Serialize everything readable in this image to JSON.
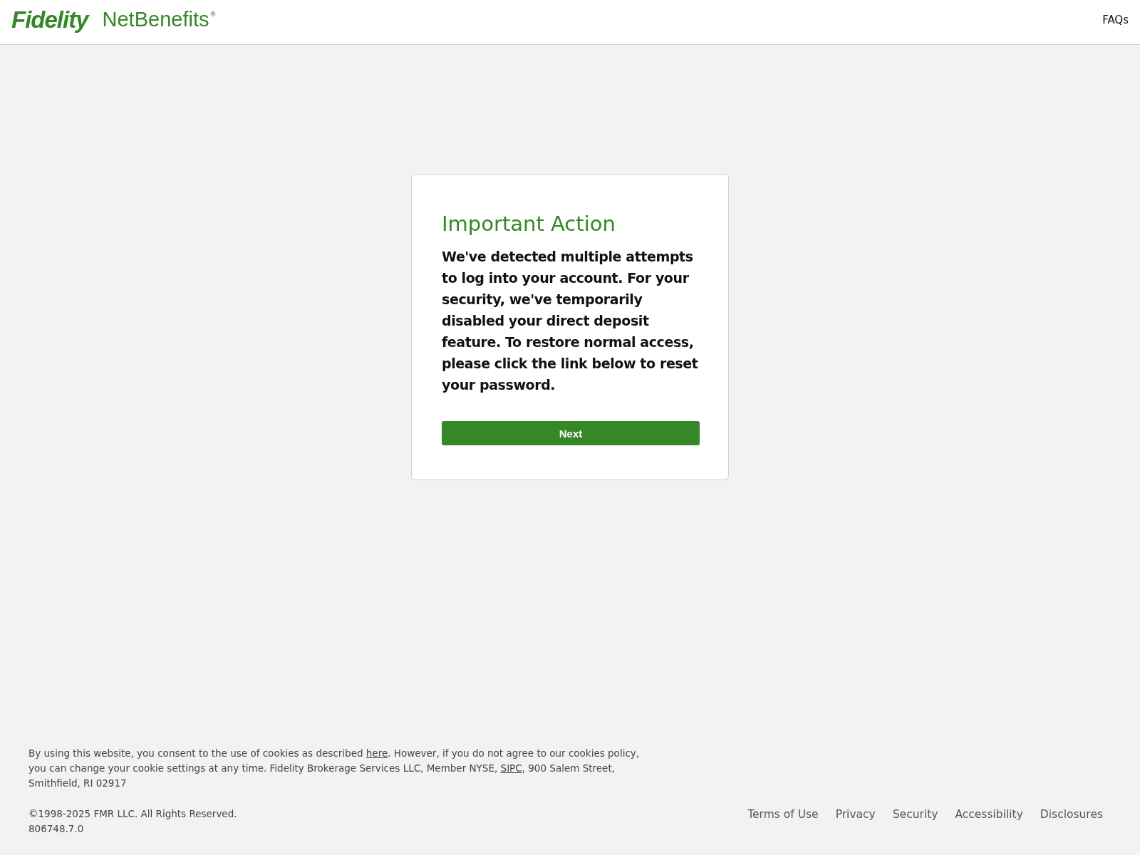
{
  "header": {
    "logo_brand": "Fidelity",
    "logo_product": "NetBenefits",
    "logo_mark": "®",
    "faqs_link": "FAQs"
  },
  "card": {
    "title": "Important Action",
    "message": "We've detected multiple attempts to log into your account. For your security, we've temporarily disabled your direct deposit feature. To restore normal access, please click the link below to reset your password.",
    "button": "Next"
  },
  "footer": {
    "cookie_notice": [
      {
        "kind": "text",
        "text": "By using this website, you consent to the use of cookies as described "
      },
      {
        "kind": "link",
        "text": "here"
      },
      {
        "kind": "text",
        "text": ". However, if you do not agree to our cookies policy, you can change your cookie settings at any time. Fidelity Brokerage Services LLC, Member NYSE, "
      },
      {
        "kind": "link",
        "text": "SIPC"
      },
      {
        "kind": "text",
        "text": ", 900 Salem Street, Smithfield, RI 02917"
      }
    ],
    "copyright": "©1998-2025 FMR LLC. All Rights Reserved.",
    "version": "806748.7.0",
    "links": [
      "Terms of Use",
      "Privacy",
      "Security",
      "Accessibility",
      "Disclosures"
    ]
  }
}
